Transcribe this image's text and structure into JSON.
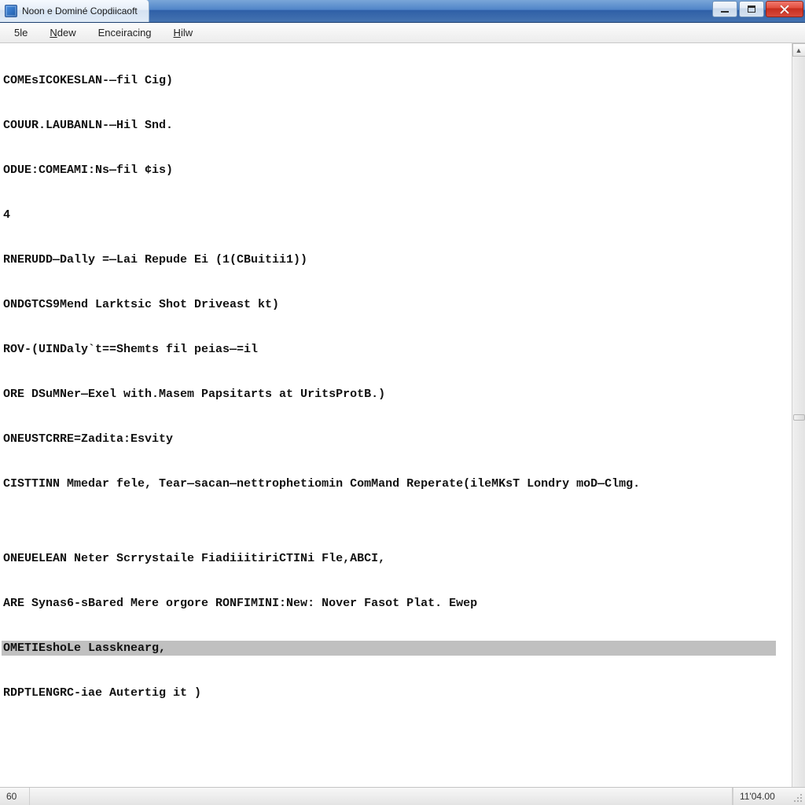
{
  "window": {
    "title": "Noon e Dominé Copdiicaoft"
  },
  "menu": {
    "file": "5le",
    "view": "Ndew",
    "encoding": "Enceiracing",
    "hilw": "Hilw"
  },
  "editor": {
    "lines": [
      "COMEsICOKESLAN-—fil Cig)",
      "COUUR.LAUBANLN-—Hil Snd.",
      "ODUE:COMEAMI:Ns—fil ¢is)",
      "4",
      "RNERUDD—Dally =—Lai Repude Ei (1(CBuitii1))",
      "ONDGTCS9Mend Larktsic Shot Driveast kt)",
      "ROV-(UINDaly`t==Shemts fil peias—=il",
      "ORE DSuMNer—Exel with.Masem Papsitarts at UritsProtB.)",
      "ONEUSTCRRE=Zadita:Esvity",
      "CISTTINN Mmedar fele, Tear—sacan—nettrophetiomin ComMand Reperate(ileMKsT Londry moD—Clmg.",
      "",
      "ONEUELEAN Neter Scrrystaile FiadiiitiriCTINi Fle,ABCI,",
      "ARE Synas6-sBared Mere orgore RONFIMINI:New: Nover Fasot Plat. Ewep",
      "OMETIEshoLe Lassknearg,",
      "RDPTLENGRC-iae Autertig it )"
    ],
    "selected_index": 13
  },
  "statusbar": {
    "left": "60",
    "position": "11'04.00"
  },
  "icons": {
    "scroll_up": "▲",
    "scroll_down": "▼"
  }
}
